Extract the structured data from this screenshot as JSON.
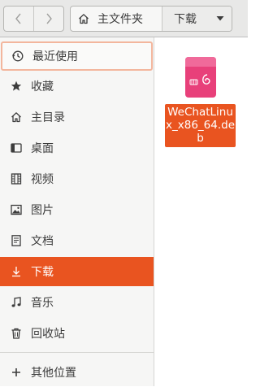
{
  "toolbar": {
    "back_icon": "chevron-left-icon",
    "forward_icon": "chevron-right-icon"
  },
  "pathbar": {
    "home_label": "主文件夹",
    "current_label": "下载"
  },
  "sidebar": {
    "items": [
      {
        "label": "最近使用",
        "icon": "clock-icon",
        "state": "focused"
      },
      {
        "label": "收藏",
        "icon": "star-icon",
        "state": "normal"
      },
      {
        "label": "主目录",
        "icon": "home-icon",
        "state": "normal"
      },
      {
        "label": "桌面",
        "icon": "desktop-icon",
        "state": "normal"
      },
      {
        "label": "视频",
        "icon": "film-icon",
        "state": "normal"
      },
      {
        "label": "图片",
        "icon": "image-icon",
        "state": "normal"
      },
      {
        "label": "文档",
        "icon": "document-icon",
        "state": "normal"
      },
      {
        "label": "下载",
        "icon": "download-icon",
        "state": "selected"
      },
      {
        "label": "音乐",
        "icon": "music-icon",
        "state": "normal"
      },
      {
        "label": "回收站",
        "icon": "trash-icon",
        "state": "normal"
      },
      {
        "label": "其他位置",
        "icon": "plus-icon",
        "state": "normal"
      }
    ]
  },
  "files": [
    {
      "name": "WeChatLinux_x86_64.deb",
      "icon": "debian-package-icon",
      "selected": true
    }
  ],
  "colors": {
    "accent": "#e95420",
    "package_icon": "#e8407a"
  }
}
